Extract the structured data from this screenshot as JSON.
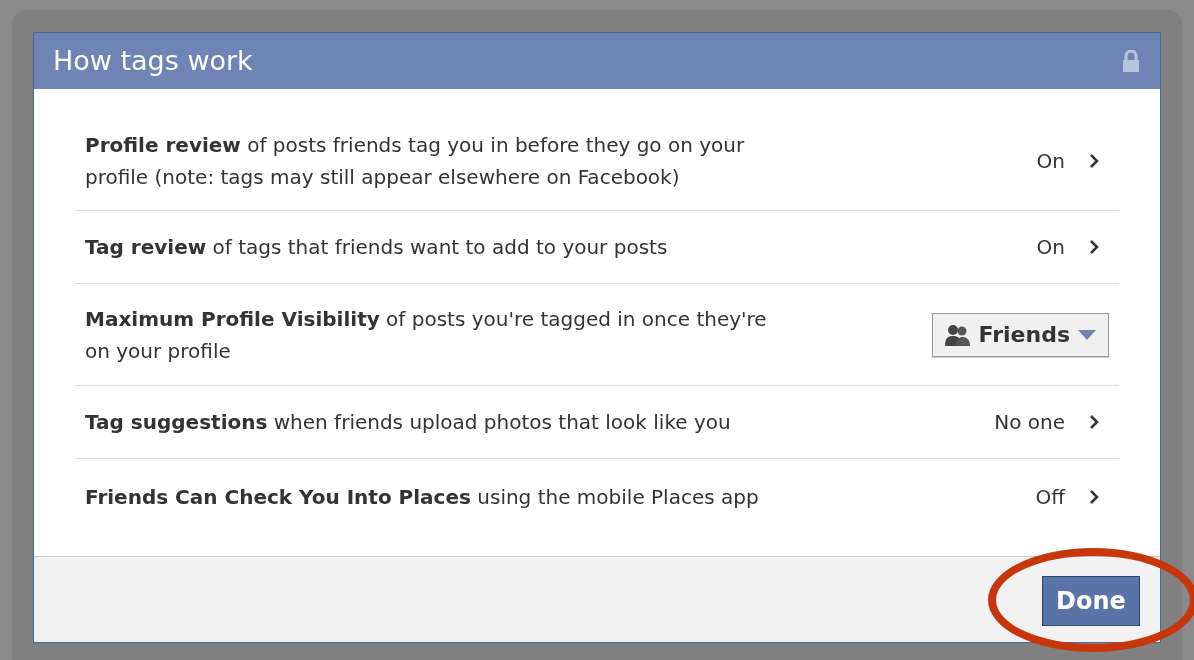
{
  "dialog": {
    "title": "How tags work",
    "locked": true
  },
  "settings": [
    {
      "kind": "link",
      "text": "**Profile review** of posts friends tag you in before they go on your profile (note: tags may still appear elsewhere on Facebook)",
      "value": "On"
    },
    {
      "kind": "link",
      "text": "**Tag review** of tags that friends want to add to your posts",
      "value": "On"
    },
    {
      "kind": "dropdown",
      "text": "**Maximum Profile Visibility** of posts you're tagged in once they're on your profile",
      "value": "Friends"
    },
    {
      "kind": "link",
      "text": "**Tag suggestions** when friends upload photos that look like you",
      "value": "No one"
    },
    {
      "kind": "link",
      "text": "**Friends Can Check You Into Places** using the mobile Places app",
      "value": "Off"
    }
  ],
  "footer": {
    "button": "Done",
    "highlighted": true
  }
}
